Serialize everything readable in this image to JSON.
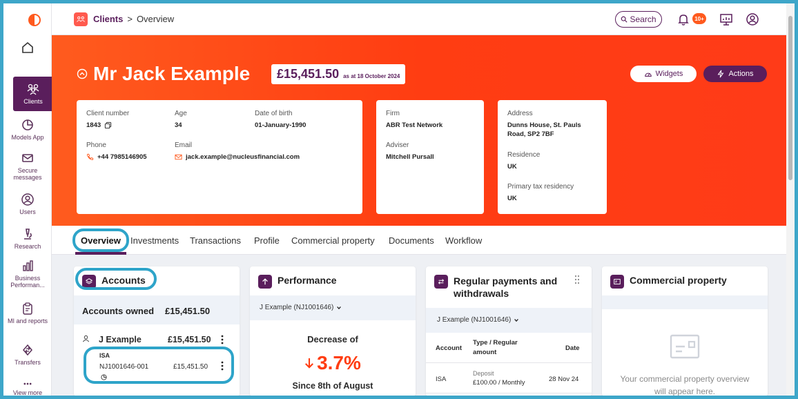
{
  "sidebar": {
    "items": [
      {
        "label": ""
      },
      {
        "label": "Clients"
      },
      {
        "label": "Models App"
      },
      {
        "label": "Secure messages"
      },
      {
        "label": "Users"
      },
      {
        "label": "Research"
      },
      {
        "label": "Business Performan..."
      },
      {
        "label": "MI and reports"
      },
      {
        "label": "Transfers"
      },
      {
        "label": "View more"
      }
    ]
  },
  "topbar": {
    "breadcrumb_root": "Clients",
    "breadcrumb_sep": ">",
    "breadcrumb_current": "Overview",
    "search_label": "Search",
    "notification_count": "10+"
  },
  "client": {
    "name": "Mr Jack Example",
    "value": "£15,451.50",
    "as_at": "as at 18 October 2024",
    "widgets_label": "Widgets",
    "actions_label": "Actions",
    "client_number_label": "Client number",
    "client_number": "1843",
    "age_label": "Age",
    "age": "34",
    "dob_label": "Date of birth",
    "dob": "01-January-1990",
    "phone_label": "Phone",
    "phone": "+44 7985146905",
    "email_label": "Email",
    "email": "jack.example@nucleusfinancial.com",
    "firm_label": "Firm",
    "firm": "ABR Test Network",
    "adviser_label": "Adviser",
    "adviser": "Mitchell Pursall",
    "address_label": "Address",
    "address": "Dunns House, St. Pauls Road, SP2 7BF",
    "residence_label": "Residence",
    "residence": "UK",
    "tax_label": "Primary tax residency",
    "tax": "UK"
  },
  "tabs": [
    "Overview",
    "Investments",
    "Transactions",
    "Profile",
    "Commercial property",
    "Documents",
    "Workflow"
  ],
  "accounts": {
    "title": "Accounts",
    "owned_label": "Accounts owned",
    "owned_value": "£15,451.50",
    "holder_name": "J Example",
    "holder_value": "£15,451.50",
    "product": "ISA",
    "account_id": "NJ1001646-001",
    "account_value": "£15,451.50"
  },
  "performance": {
    "title": "Performance",
    "selector": "J Example (NJ1001646)",
    "caption": "Decrease of",
    "value": "3.7%",
    "since": "Since 8th of August"
  },
  "regular": {
    "title": "Regular payments and withdrawals",
    "selector": "J Example (NJ1001646)",
    "col_account": "Account",
    "col_type": "Type / Regular amount",
    "col_date": "Date",
    "row_account": "ISA",
    "row_type": "Deposit",
    "row_amount": "£100.00 / Monthly",
    "row_date": "28 Nov 24"
  },
  "commercial": {
    "title": "Commercial property",
    "empty_text": "Your commercial property overview will appear here."
  }
}
